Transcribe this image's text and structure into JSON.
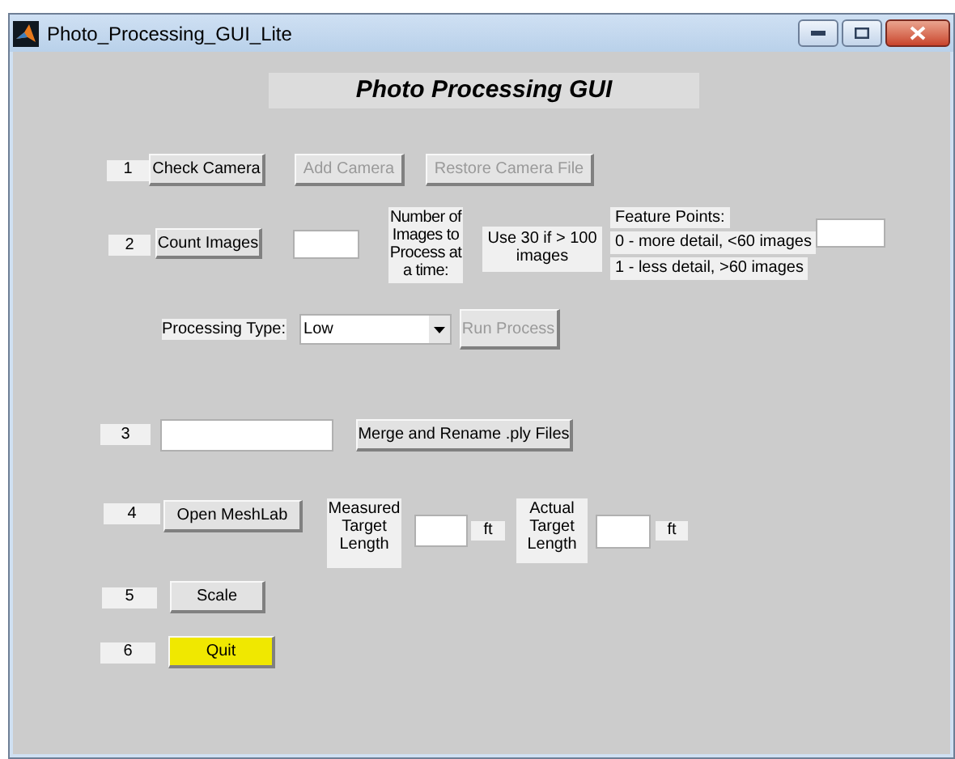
{
  "window": {
    "title": "Photo_Processing_GUI_Lite"
  },
  "heading": "Photo Processing GUI",
  "step_1": {
    "number": "1",
    "buttons": [
      {
        "label": "Check Camera",
        "disabled": false
      },
      {
        "label": "Add Camera",
        "disabled": true
      },
      {
        "label": "Restore Camera File",
        "disabled": true
      }
    ]
  },
  "step_2": {
    "number": "2",
    "button": {
      "label": "Count Images",
      "disabled": false
    },
    "images_per_batch_label": "Number of Images to Process at a time:",
    "hint": "Use 30 if > 100 images",
    "feature_points": {
      "title": "Feature Points:",
      "options": [
        "0 - more detail, <60 images",
        "1 - less detail, >60 images"
      ]
    }
  },
  "processing": {
    "label": "Processing Type:",
    "dropdown": {
      "value": "Low"
    },
    "button": {
      "label": "Run Process",
      "disabled": true
    }
  },
  "step_3": {
    "number": "3",
    "button": {
      "label": "Merge and Rename .ply Files",
      "disabled": false
    }
  },
  "step_4": {
    "number": "4",
    "button": {
      "label": "Open MeshLab",
      "disabled": false
    },
    "measured_label": "Measured Target Length",
    "measured_unit": "ft",
    "actual_label": "Actual Target Length",
    "actual_unit": "ft"
  },
  "step_5": {
    "number": "5",
    "button": {
      "label": "Scale",
      "disabled": false
    }
  },
  "step_6": {
    "number": "6",
    "button": {
      "label": "Quit",
      "disabled": false
    }
  }
}
